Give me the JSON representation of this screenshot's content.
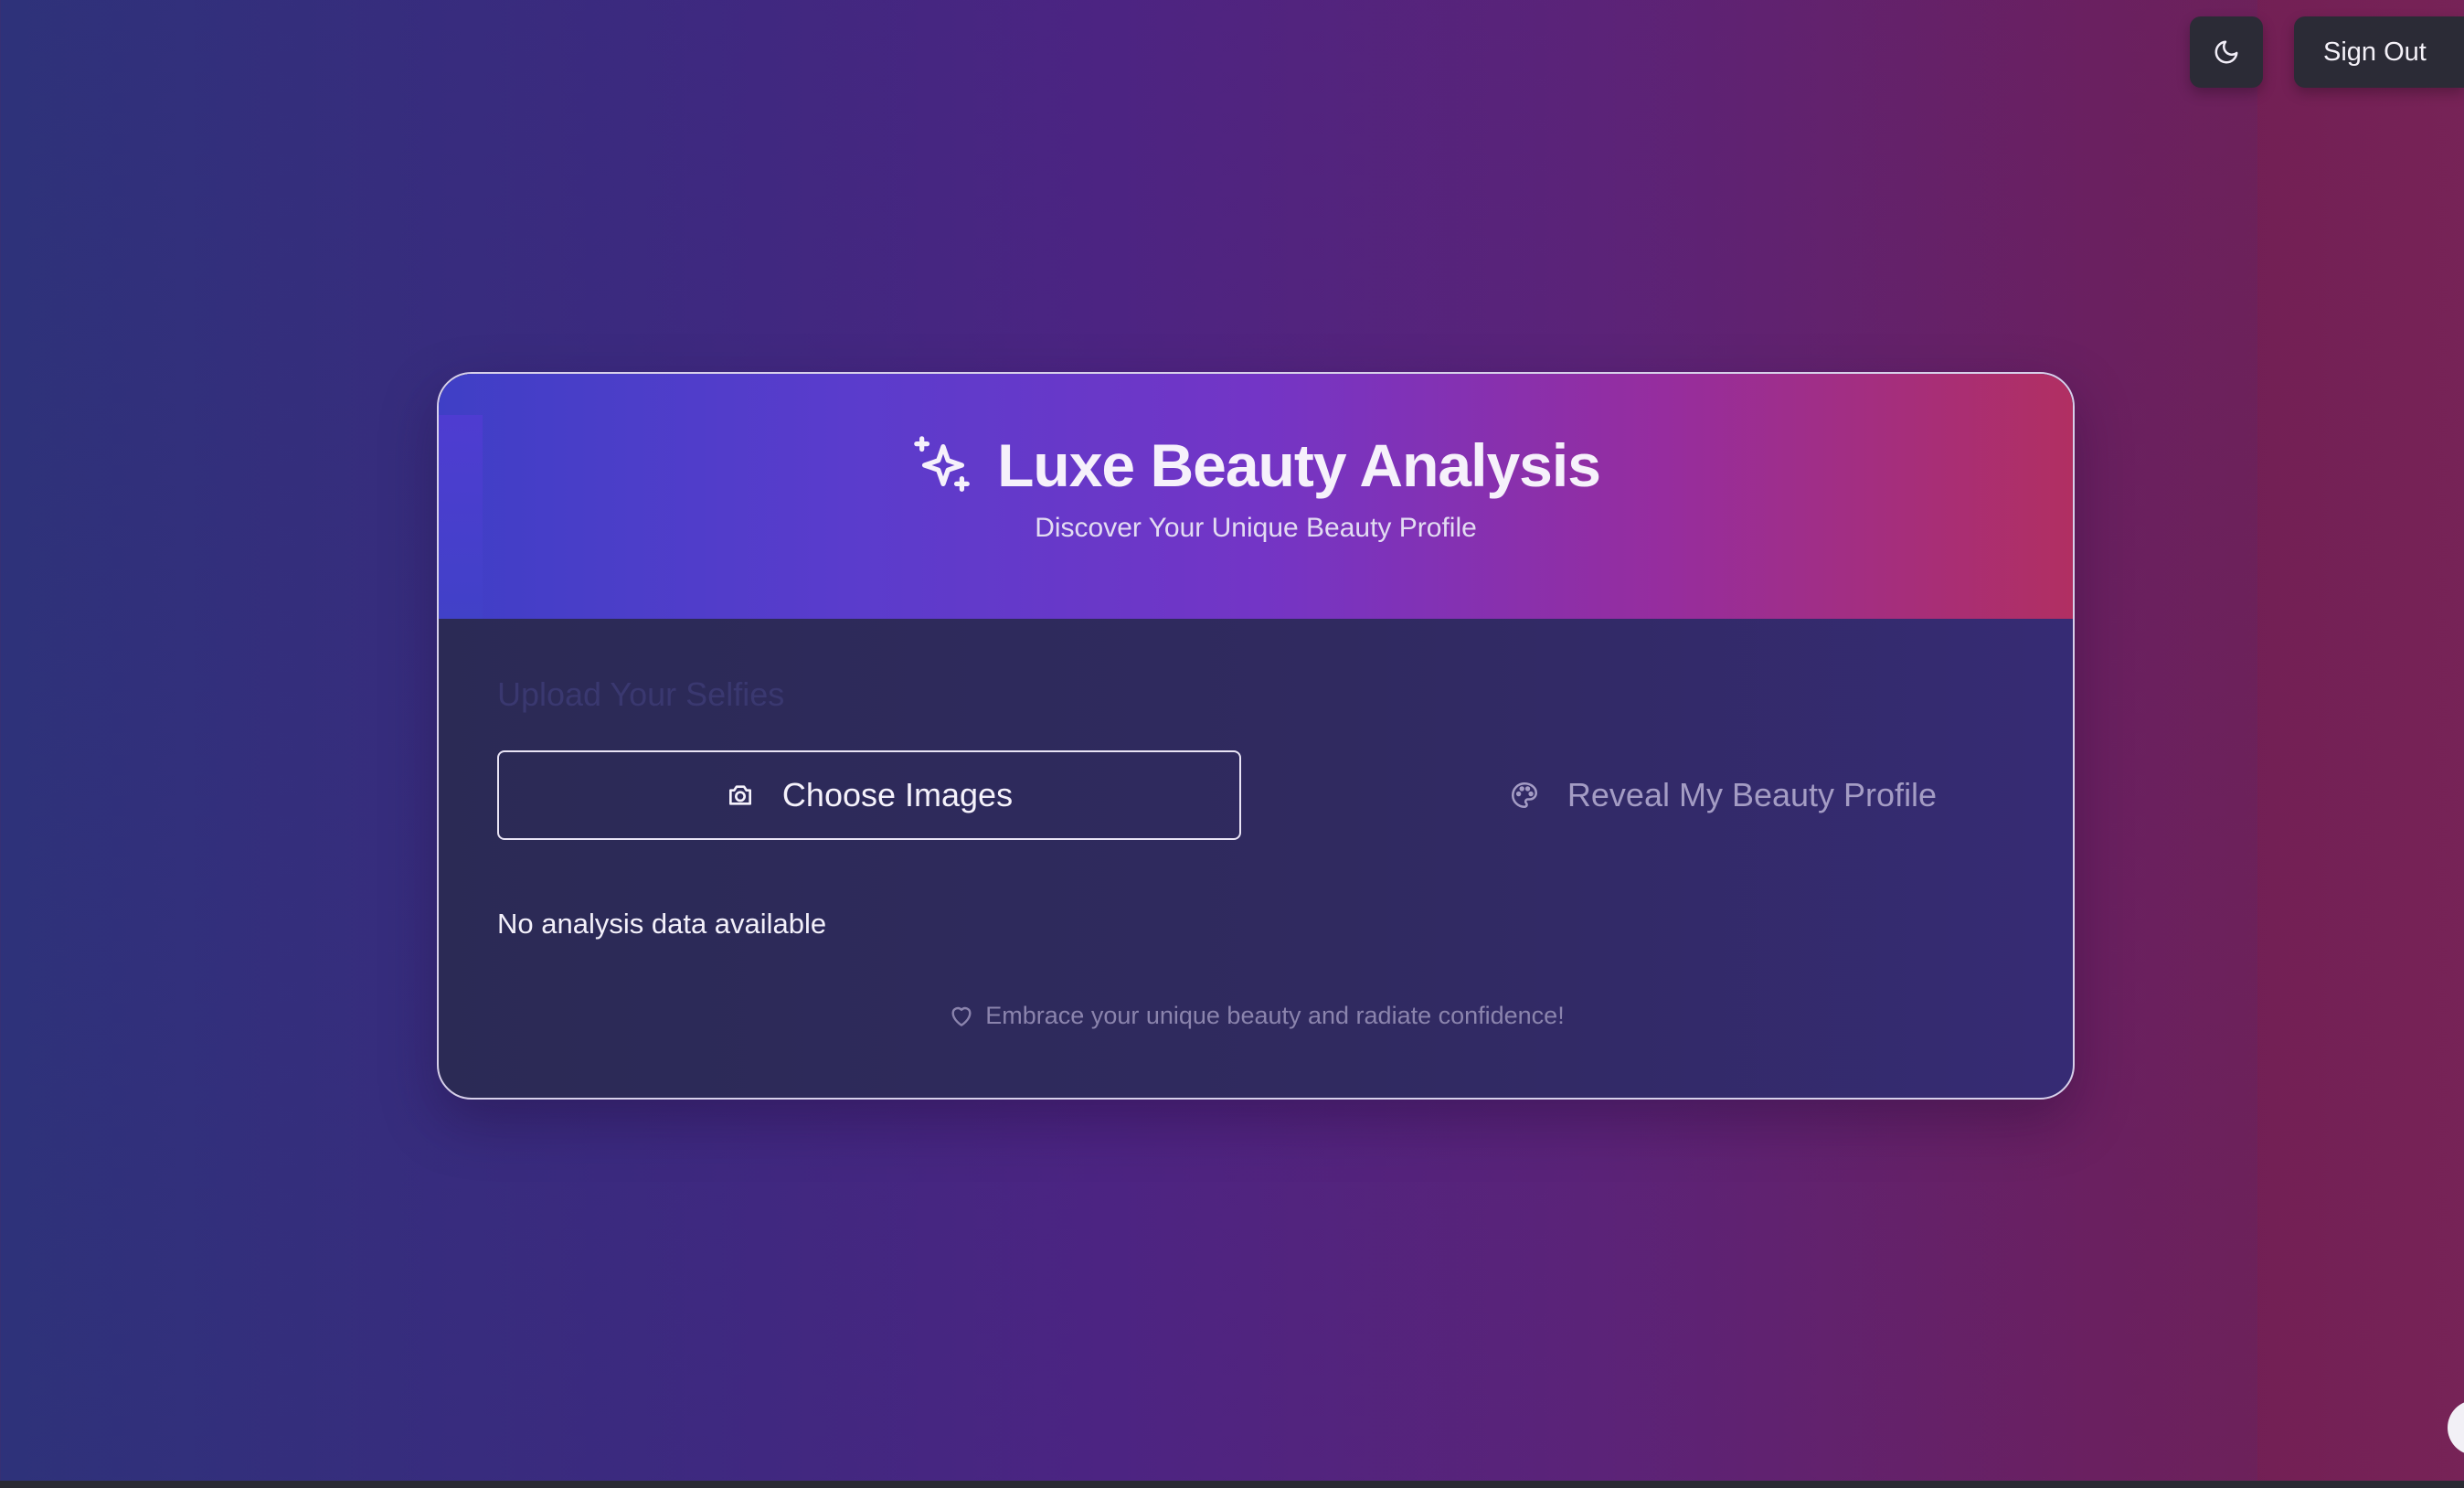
{
  "topbar": {
    "theme_icon": "moon-icon",
    "signout_label": "Sign Out"
  },
  "header": {
    "icon": "sparkles-icon",
    "title": "Luxe Beauty Analysis",
    "subtitle": "Discover Your Unique Beauty Profile"
  },
  "upload": {
    "label": "Upload Your Selfies",
    "choose_label": "Choose Images",
    "choose_icon": "camera-icon",
    "reveal_label": "Reveal My Beauty Profile",
    "reveal_icon": "palette-icon"
  },
  "status": {
    "no_data": "No analysis data available"
  },
  "footer": {
    "icon": "heart-icon",
    "note": "Embrace your unique beauty and radiate confidence!"
  },
  "colors": {
    "header_start": "#3f3fc6",
    "header_end": "#b12f62",
    "card_bg": "#2b2a55"
  }
}
